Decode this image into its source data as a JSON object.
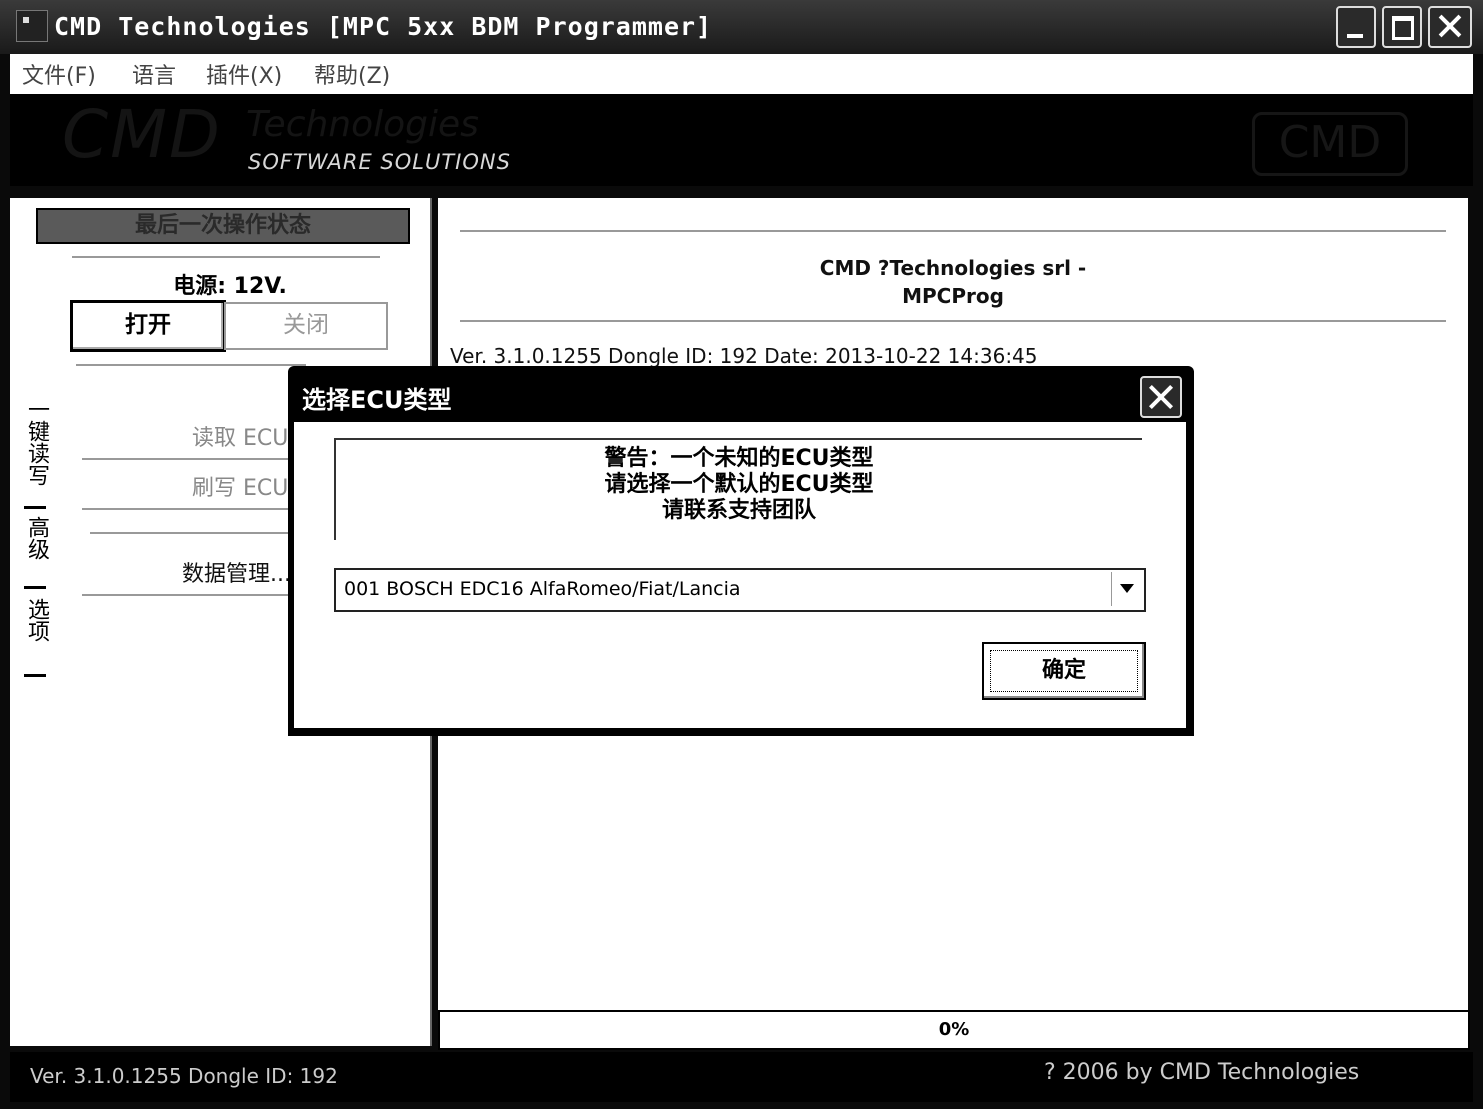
{
  "window": {
    "title": "CMD Technologies [MPC 5xx BDM Programmer]"
  },
  "menu": [
    "文件(F)",
    "语言",
    "插件(X)",
    "帮助(Z)"
  ],
  "banner": {
    "brand": "CMD",
    "tech": "Technologies",
    "subtitle": "SOFTWARE SOLUTIONS",
    "logo": "CMD"
  },
  "left": {
    "status_header": "最后一次操作状态",
    "power_label": "电源: 12V.",
    "open_label": "打开",
    "close_label": "关闭",
    "tabs": [
      "一键读写",
      "高级",
      "选项"
    ],
    "read_ecu": "读取 ECU",
    "write_ecu": "刷写 ECU",
    "data_mgmt": "数据管理..."
  },
  "right": {
    "title_line1": "CMD ?Technologies srl -",
    "title_line2": "MPCProg",
    "version_line": "Ver. 3.1.0.1255    Dongle ID: 192    Date: 2013-10-22 14:36:45",
    "progress": "0%"
  },
  "statusbar": {
    "left": "Ver. 3.1.0.1255    Dongle ID: 192",
    "right": "? 2006 by CMD Technologies"
  },
  "dialog": {
    "title": "选择ECU类型",
    "warning": [
      "警告：一个未知的ECU类型",
      "请选择一个默认的ECU类型",
      "请联系支持团队"
    ],
    "selected_ecu": "001  BOSCH EDC16 AlfaRomeo/Fiat/Lancia",
    "ok_label": "确定"
  }
}
